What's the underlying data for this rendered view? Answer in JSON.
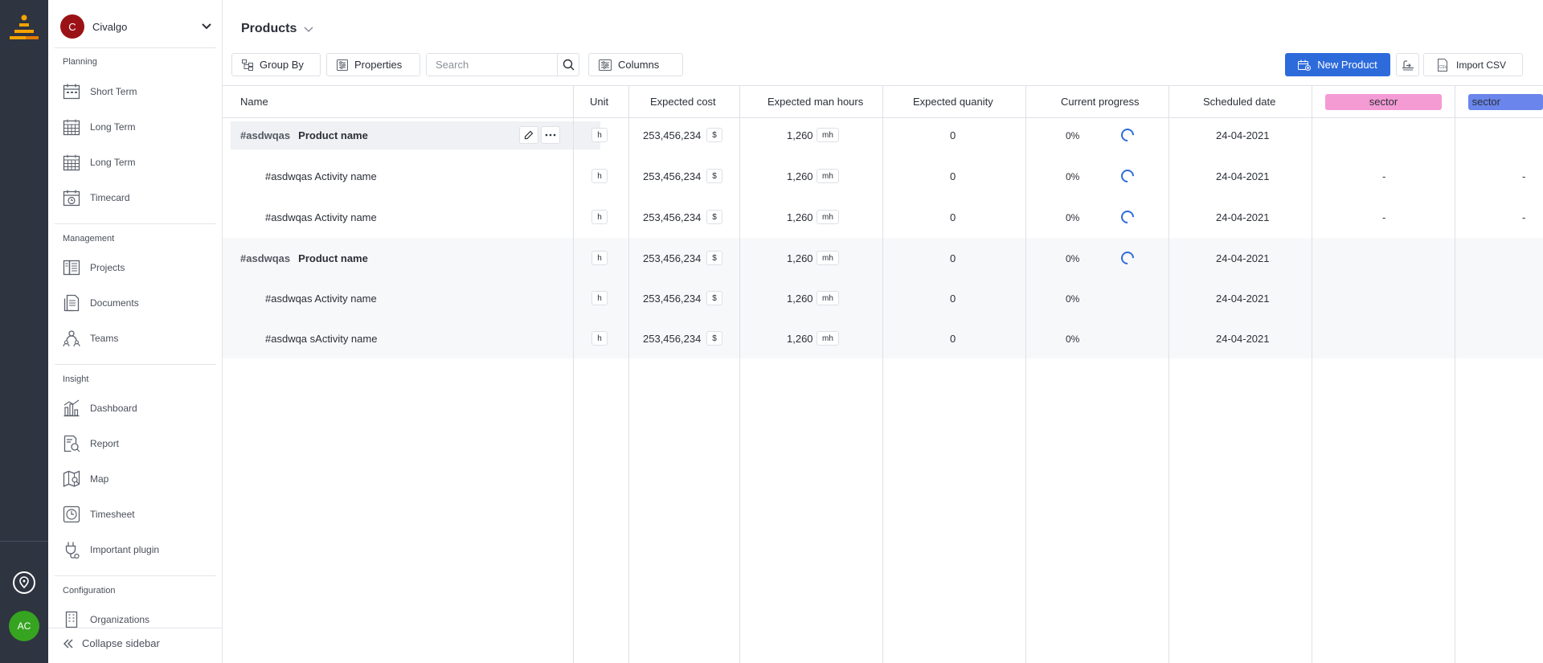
{
  "org": {
    "initial": "C",
    "name": "Civalgo"
  },
  "rail": {
    "avatar_initials": "AC"
  },
  "sidebar": {
    "sections": [
      {
        "title": "Planning",
        "items": [
          {
            "label": "Short Term",
            "icon": "calendar-short-icon"
          },
          {
            "label": "Long Term",
            "icon": "calendar-long-icon"
          },
          {
            "label": "Long Term",
            "icon": "calendar-long-icon"
          },
          {
            "label": "Timecard",
            "icon": "timecard-icon"
          }
        ]
      },
      {
        "title": "Management",
        "items": [
          {
            "label": "Projects",
            "icon": "projects-icon"
          },
          {
            "label": "Documents",
            "icon": "documents-icon"
          },
          {
            "label": "Teams",
            "icon": "teams-icon"
          }
        ]
      },
      {
        "title": "Insight",
        "items": [
          {
            "label": "Dashboard",
            "icon": "dashboard-icon"
          },
          {
            "label": "Report",
            "icon": "report-icon"
          },
          {
            "label": "Map",
            "icon": "map-icon"
          },
          {
            "label": "Timesheet",
            "icon": "clock-icon"
          },
          {
            "label": "Important plugin",
            "icon": "plugin-icon"
          }
        ]
      },
      {
        "title": "Configuration",
        "items": [
          {
            "label": "Organizations",
            "icon": "building-icon"
          }
        ]
      }
    ],
    "collapse_label": "Collapse sidebar"
  },
  "page": {
    "title": "Products"
  },
  "toolbar": {
    "group_by": "Group By",
    "properties": "Properties",
    "search_placeholder": "Search",
    "columns": "Columns",
    "new_product": "New Product",
    "import_csv": "Import CSV"
  },
  "table": {
    "headers": [
      "Name",
      "Unit",
      "Expected cost",
      "Expected man hours",
      "Expected quanity",
      "Current progress",
      "Scheduled date",
      "sector",
      "sector"
    ],
    "sector_colors": [
      "#f49bd4",
      "#6a86ec"
    ],
    "rows": [
      {
        "type": "product",
        "code": "#asdwqas",
        "name": "Product name",
        "unit": "h",
        "cost": "253,456,234",
        "currency": "$",
        "hours": "1,260",
        "hours_unit": "mh",
        "quantity": "0",
        "progress": "0%",
        "spinner": true,
        "date": "24-04-2021",
        "sector1": "",
        "sector2": "",
        "highlight": true
      },
      {
        "type": "activity",
        "name": "#asdwqas Activity name",
        "unit": "h",
        "cost": "253,456,234",
        "currency": "$",
        "hours": "1,260",
        "hours_unit": "mh",
        "quantity": "0",
        "progress": "0%",
        "spinner": true,
        "date": "24-04-2021",
        "sector1": "-",
        "sector2": "-"
      },
      {
        "type": "activity",
        "name": "#asdwqas Activity name",
        "unit": "h",
        "cost": "253,456,234",
        "currency": "$",
        "hours": "1,260",
        "hours_unit": "mh",
        "quantity": "0",
        "progress": "0%",
        "spinner": true,
        "date": "24-04-2021",
        "sector1": "-",
        "sector2": "-"
      },
      {
        "type": "product",
        "code": "#asdwqas",
        "name": "Product name",
        "unit": "h",
        "cost": "253,456,234",
        "currency": "$",
        "hours": "1,260",
        "hours_unit": "mh",
        "quantity": "0",
        "progress": "0%",
        "spinner": true,
        "date": "24-04-2021",
        "sector1": "",
        "sector2": ""
      },
      {
        "type": "activity",
        "name": "#asdwqas Activity name",
        "unit": "h",
        "cost": "253,456,234",
        "currency": "$",
        "hours": "1,260",
        "hours_unit": "mh",
        "quantity": "0",
        "progress": "0%",
        "spinner": false,
        "date": "24-04-2021",
        "sector1": "",
        "sector2": ""
      },
      {
        "type": "activity",
        "name": "#asdwqa sActivity name",
        "unit": "h",
        "cost": "253,456,234",
        "currency": "$",
        "hours": "1,260",
        "hours_unit": "mh",
        "quantity": "0",
        "progress": "0%",
        "spinner": false,
        "date": "24-04-2021",
        "sector1": "",
        "sector2": ""
      }
    ]
  }
}
